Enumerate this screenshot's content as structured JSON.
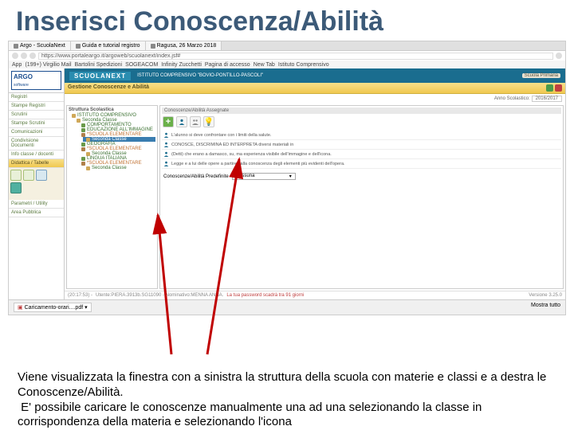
{
  "slide": {
    "title": "Inserisci Conoscenza/Abilità",
    "caption": "Viene visualizzata la finestra con a sinistra la struttura della scuola con materie e classi e a destra le Conoscenze/Abilità.\nE' possibile caricare le conoscenze manualmente una ad una selezionando la classe in corrispondenza della materia e selezionando l'icona"
  },
  "browser": {
    "tabs": [
      "Argo - ScuolaNext",
      "Guida e tutorial registro",
      "Ragusa, 26 Marzo 2018"
    ],
    "url": "https://www.portaleargo.it/argoweb/scuolanext/index.jsf#",
    "bookmarks": [
      "App",
      "(199+) Virgilio Mail",
      "Bartolini Spedizioni",
      "SOGEACOM",
      "Infinity Zucchetti",
      "Pagina di accesso",
      "New Tab",
      "Istituto Comprensivo"
    ]
  },
  "app": {
    "logo": "ARGO",
    "logo_sub": "software",
    "brand": "SCUOLANEXT",
    "institute": "ISTITUTO COMPRENSIVO \"BOVIO-PONTILLO-PASCOLI\"",
    "school_badge": "Scuola Primaria",
    "sidebar": {
      "items": [
        "Registri",
        "Stampe Registri",
        "Scrutini",
        "Stampe Scrutini",
        "Comunicazioni",
        "Condivisione Documenti",
        "Info classe / docenti",
        "Didattica / Tabelle",
        "Parametri / Utility",
        "Area Pubblica"
      ]
    },
    "panel_title": "Gestione Conoscenze e Abilità",
    "year_label": "Anno Scolastico:",
    "year_value": "2016/2017",
    "tree": {
      "head": "Struttura Scolastica",
      "root": "ISTITUTO COMPRENSIVO",
      "sections": [
        {
          "label": "Seconda Classe",
          "items": [
            "COMPORTAMENTO",
            "EDUCAZIONE ALL'IMMAGINE"
          ]
        },
        {
          "label": "*SCUOLA ELEMENTARE",
          "hl": "Seconda Classe",
          "items": [
            "GEOGRAFIA"
          ]
        },
        {
          "label": "*SCUOLA ELEMENTARE",
          "sub": "Seconda Classe",
          "items": [
            "LINGUA ITALIANA"
          ]
        },
        {
          "label": "*SCUOLA ELEMENTARE",
          "sub": "Seconda Classe"
        }
      ]
    },
    "right": {
      "head": "Conoscenze/Abilità Assegnate",
      "rows": [
        "L'alunno si deve confrontare con i limiti della salute.",
        "CONOSCE, DISCRIMINA ED INTERPRETA diversi materiali in",
        "(Detti) che erano a damasco, su, ma esperienza visibile dell'immagine e dell'icona.",
        "Legge e a lui delle opere a partire dalla conoscenza degli elementi più evidenti dell'opera."
      ],
      "predef_label": "Conoscenze/Abilità Predefinite",
      "predef_value": "Nessuna"
    },
    "status": {
      "time": "(20:17:53) - ",
      "user": "Utente:PIERA.3913b.SG11090 - Nominativo:MENNA ANNA.",
      "pwd": "La tua password scadrà tra 91 giorni",
      "version": "Versione 3.25.0"
    },
    "download": {
      "file": "Caricamento-orari....pdf",
      "show_all": "Mostra tutto"
    }
  }
}
